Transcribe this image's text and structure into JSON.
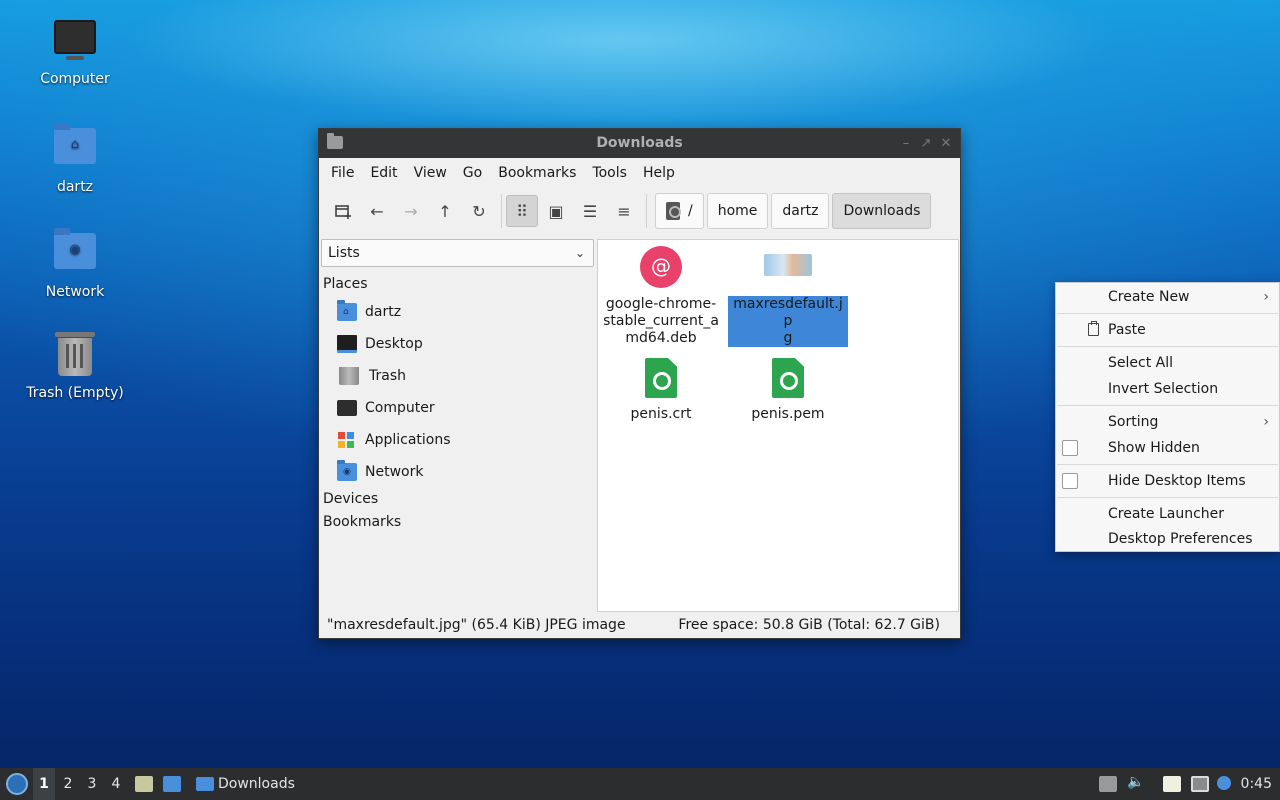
{
  "desktop": {
    "icons": [
      {
        "label": "Computer"
      },
      {
        "label": "dartz"
      },
      {
        "label": "Network"
      },
      {
        "label": "Trash (Empty)"
      }
    ]
  },
  "window": {
    "title": "Downloads",
    "controls": {
      "minimize": "–",
      "maximize": "↗",
      "close": "✕"
    },
    "menu": [
      "File",
      "Edit",
      "View",
      "Go",
      "Bookmarks",
      "Tools",
      "Help"
    ],
    "toolbar": {
      "new_tab_icon": "new-tab-icon",
      "back_icon": "←",
      "forward_icon": "→",
      "up_icon": "↑",
      "reload_icon": "↻",
      "icon_view": "⠿",
      "thumbnail_view": "▣",
      "compact_view": "☰",
      "detailed_view": "≡"
    },
    "breadcrumb": [
      "/",
      "home",
      "dartz",
      "Downloads"
    ],
    "sidepane": {
      "mode": "Lists",
      "places_header": "Places",
      "places": [
        "dartz",
        "Desktop",
        "Trash",
        "Computer",
        "Applications",
        "Network"
      ],
      "devices_header": "Devices",
      "bookmarks_header": "Bookmarks"
    },
    "files": [
      {
        "name": "google-chrome-stable_current_amd64.deb",
        "display": "google-chrome-\nstable_current_a\nmd64.deb",
        "selected": false
      },
      {
        "name": "maxresdefault.jpg",
        "display": "maxresdefault.jp\ng",
        "selected": true
      },
      {
        "name": "penis.crt",
        "display": "penis.crt",
        "selected": false
      },
      {
        "name": "penis.pem",
        "display": "penis.pem",
        "selected": false
      }
    ],
    "status": {
      "left": "\"maxresdefault.jpg\" (65.4 KiB) JPEG image",
      "right": "Free space: 50.8 GiB (Total: 62.7 GiB)"
    }
  },
  "context_menu": {
    "create_new": "Create New",
    "paste": "Paste",
    "select_all": "Select All",
    "invert_selection": "Invert Selection",
    "sorting": "Sorting",
    "show_hidden": "Show Hidden",
    "hide_desktop_items": "Hide Desktop Items",
    "create_launcher": "Create Launcher",
    "desktop_preferences": "Desktop Preferences",
    "submenu_arrow": "›"
  },
  "taskbar": {
    "workspaces": [
      "1",
      "2",
      "3",
      "4"
    ],
    "active_workspace": "1",
    "task_label": "Downloads",
    "clock": "0:45"
  },
  "colors": {
    "selection": "#3d86d8",
    "folder": "#4a8fdc",
    "titlebar": "#333536",
    "taskbar": "#2b2d2f"
  }
}
